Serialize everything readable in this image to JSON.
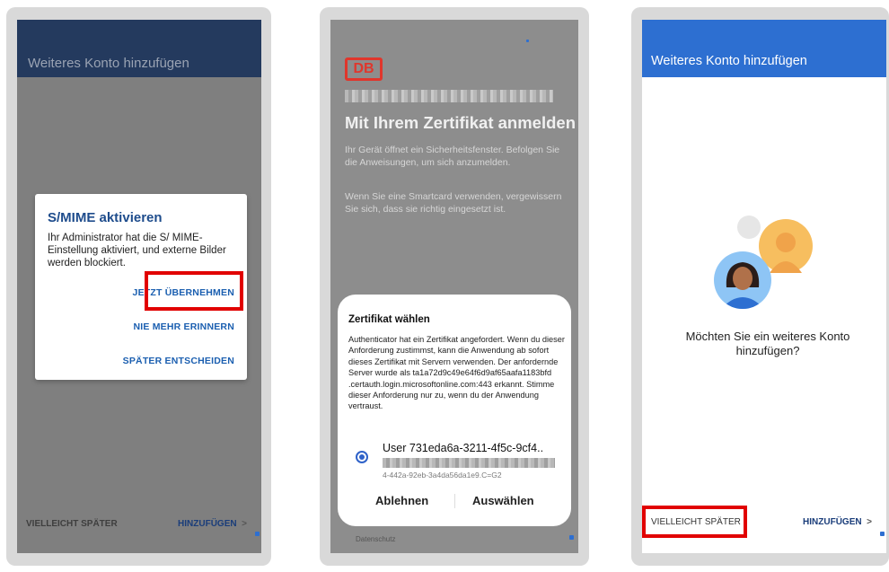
{
  "screen1": {
    "header_title": "Weiteres Konto hinzufügen",
    "dialog_title": "S/MIME aktivieren",
    "dialog_body": "Ihr Administrator hat die S/ MIME-Einstellung aktiviert, und externe Bilder werden blockiert.",
    "btn_apply": "JETZT ÜBERNEHMEN",
    "btn_never": "NIE MEHR ERINNERN",
    "btn_later": "SPÄTER ENTSCHEIDEN",
    "footer_left": "VIELLEICHT SPÄTER",
    "footer_right": "HINZUFÜGEN",
    "chevron": ">"
  },
  "screen2": {
    "logo": "DB",
    "heading": "Mit Ihrem Zertifikat anmelden",
    "text1": "Ihr Gerät öffnet ein Sicherheitsfenster. Befolgen Sie die Anweisungen, um sich anzumelden.",
    "text2": "Wenn Sie eine Smartcard verwenden, vergewissern Sie sich, dass sie richtig eingesetzt ist.",
    "sheet_title": "Zertifikat wählen",
    "sheet_body": "Authenticator hat ein Zertifikat angefordert. Wenn du dieser Anforderung zustimmst, kann die Anwendung ab sofort dieses Zertifikat mit Servern verwenden. Der anfordernde Server wurde als ta1a72d9c49e64f6d9af65aafa1183bfd .certauth.login.microsoftonline.com:443 erkannt. Stimme dieser Anforderung nur zu, wenn du der Anwendung vertraust.",
    "user": "User 731eda6a-3211-4f5c-9cf4..",
    "user_sub": "4-442a-92eb-3a4da56da1e9.C=G2",
    "btn_reject": "Ablehnen",
    "btn_select": "Auswählen",
    "footer_text": "Datenschutz"
  },
  "screen3": {
    "header_title": "Weiteres Konto hinzufügen",
    "question": "Möchten Sie ein weiteres Konto hinzufügen?",
    "footer_left": "VIELLEICHT SPÄTER",
    "footer_right": "HINZUFÜGEN",
    "chevron": ">"
  },
  "colors": {
    "highlight": "#e10000",
    "outlook_blue": "#2d6fd1",
    "db_red": "#e0362c"
  }
}
